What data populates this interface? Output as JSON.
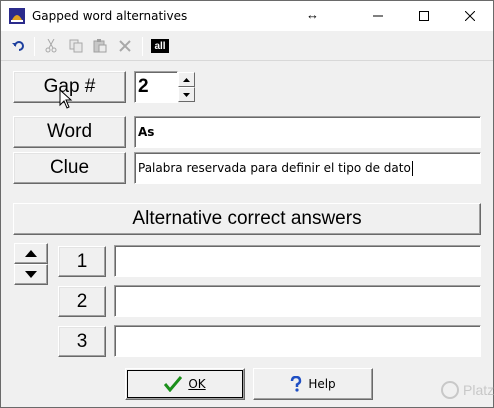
{
  "window": {
    "title": "Gapped word alternatives",
    "minimize_icon": "minimize-icon",
    "maximize_icon": "maximize-icon",
    "close_icon": "close-icon"
  },
  "toolbar": {
    "icons": [
      "undo-icon",
      "cut-icon",
      "copy-icon",
      "paste-icon",
      "delete-icon"
    ],
    "all_label": "all"
  },
  "form": {
    "gap_label": "Gap #",
    "gap_value": "2",
    "word_label": "Word",
    "word_value": "As",
    "clue_label": "Clue",
    "clue_value": "Palabra reservada para definir el tipo de dato"
  },
  "alternatives": {
    "heading": "Alternative correct answers",
    "rows": [
      {
        "number": "1",
        "value": ""
      },
      {
        "number": "2",
        "value": ""
      },
      {
        "number": "3",
        "value": ""
      }
    ]
  },
  "footer": {
    "ok_label": "OK",
    "help_label": "Help"
  },
  "watermark": {
    "text": "Platzi"
  },
  "colors": {
    "ok_check": "#1a8f1a",
    "help_icon": "#1f4fc4"
  }
}
